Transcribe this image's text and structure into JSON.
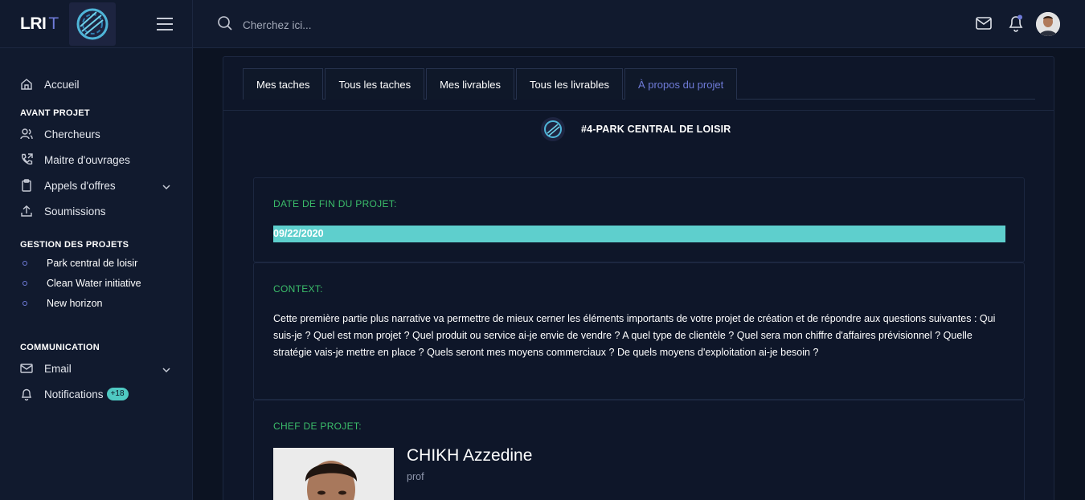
{
  "brand": {
    "name": "LRI",
    "suffix": "T"
  },
  "search": {
    "placeholder": "Cherchez ici..."
  },
  "sidebar": {
    "home": "Accueil",
    "section_avant": "AVANT PROJET",
    "avant_items": [
      "Chercheurs",
      "Maitre d'ouvrages",
      "Appels d'offres",
      "Soumissions"
    ],
    "section_gestion": "GESTION DES PROJETS",
    "projects": [
      "Park central de loisir",
      "Clean Water initiative",
      "New horizon"
    ],
    "section_comm": "COMMUNICATION",
    "email": "Email",
    "notifications": "Notifications",
    "notifications_badge": "+18"
  },
  "tabs": [
    "Mes taches",
    "Tous les taches",
    "Mes livrables",
    "Tous les livrables",
    "À propos du projet"
  ],
  "active_tab": "À propos du projet",
  "project": {
    "title": "#4-PARK CENTRAL DE LOISIR",
    "end_date_label": "DATE DE FIN DU PROJET:",
    "end_date": "09/22/2020",
    "context_label": "CONTEXT:",
    "context_text": "Cette première partie plus narrative va permettre de mieux cerner les éléments importants de votre projet de création et de répondre aux questions suivantes : Qui suis-je ? Quel est mon projet ? Quel produit ou service ai-je envie de vendre ? A quel type de clientèle ? Quel sera mon chiffre d'affaires prévisionnel ? Quelle stratégie vais-je mettre en place ? Quels seront mes moyens commerciaux ? De quels moyens d'exploitation ai-je besoin ?",
    "chef_label": "CHEF DE PROJET:",
    "chef_name": "CHIKH Azzedine",
    "chef_role": "prof"
  },
  "colors": {
    "accent": "#6f7bd8",
    "green": "#3bbd6a",
    "teal": "#5ecfcd",
    "bg": "#0c1322"
  }
}
